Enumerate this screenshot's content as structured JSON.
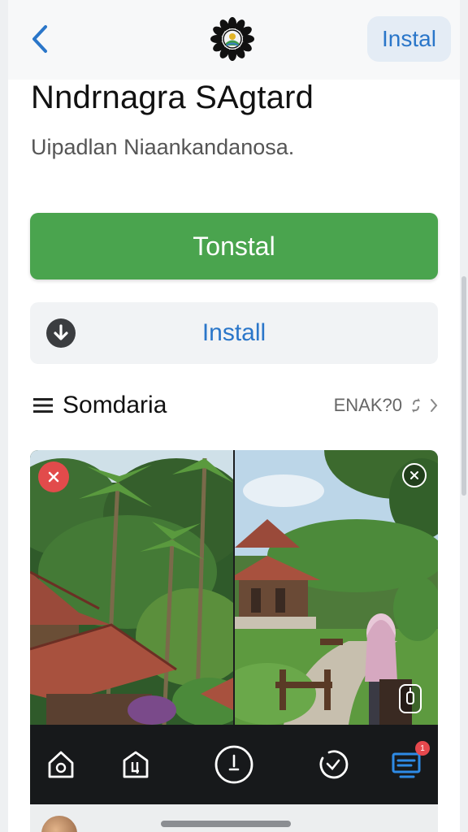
{
  "header": {
    "install_label": "Instal"
  },
  "app": {
    "title": "Nndrnagra SAgtard",
    "subtitle": "Uipadlan Niaankandanosa."
  },
  "actions": {
    "primary_label": "Tonstal",
    "install_label": "Install"
  },
  "section": {
    "title": "Somdaria",
    "meta": "ENAK?0"
  },
  "media_bar": {
    "notification_count": "1"
  },
  "colors": {
    "accent_blue": "#2a76c9",
    "primary_green": "#4aa44e",
    "close_red": "#e24b4b"
  }
}
